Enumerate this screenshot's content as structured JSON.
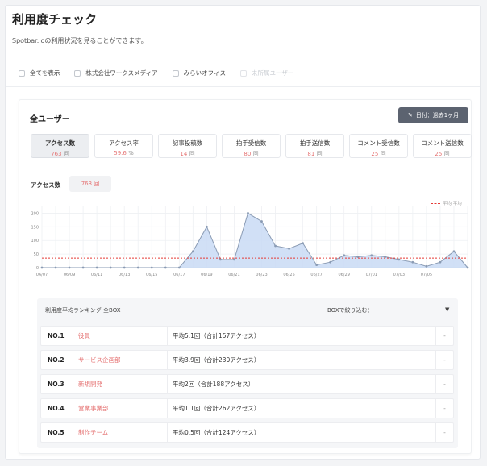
{
  "page": {
    "title": "利用度チェック",
    "description": "Spotbar.ioの利用状況を見ることができます。"
  },
  "filters": [
    {
      "label": "全てを表示",
      "disabled": false
    },
    {
      "label": "株式会社ワークスメディア",
      "disabled": false
    },
    {
      "label": "みらいオフィス",
      "disabled": false
    },
    {
      "label": "未所属ユーザー",
      "disabled": true
    }
  ],
  "card": {
    "title": "全ユーザー",
    "date_button": "日付：過去1ヶ月"
  },
  "tabs": [
    {
      "label": "アクセス数",
      "value": "763",
      "unit": "回",
      "active": true
    },
    {
      "label": "アクセス率",
      "value": "59.6",
      "unit": "%",
      "active": false
    },
    {
      "label": "記事投稿数",
      "value": "14",
      "unit": "回",
      "active": false
    },
    {
      "label": "拍手受信数",
      "value": "80",
      "unit": "回",
      "active": false
    },
    {
      "label": "拍手送信数",
      "value": "81",
      "unit": "回",
      "active": false
    },
    {
      "label": "コメント受信数",
      "value": "25",
      "unit": "回",
      "active": false
    },
    {
      "label": "コメント送信数",
      "value": "25",
      "unit": "回",
      "active": false
    }
  ],
  "metric": {
    "label": "アクセス数",
    "value": "763 回"
  },
  "chart_data": {
    "type": "area",
    "x": [
      "06/07",
      "06/08",
      "06/09",
      "06/10",
      "06/11",
      "06/12",
      "06/13",
      "06/14",
      "06/15",
      "06/16",
      "06/17",
      "06/18",
      "06/19",
      "06/20",
      "06/21",
      "06/22",
      "06/23",
      "06/24",
      "06/25",
      "06/26",
      "06/27",
      "06/28",
      "06/29",
      "06/30",
      "07/01",
      "07/02",
      "07/03",
      "07/04",
      "07/05",
      "07/06"
    ],
    "x_ticks": [
      "06/07",
      "06/09",
      "06/11",
      "06/13",
      "06/15",
      "06/17",
      "06/19",
      "06/21",
      "06/23",
      "06/25",
      "06/27",
      "06/29",
      "07/01",
      "07/03",
      "07/05"
    ],
    "y_ticks": [
      "0",
      "50",
      "100",
      "150",
      "200"
    ],
    "ylim": [
      0,
      225
    ],
    "series": [
      {
        "values": [
          0,
          0,
          0,
          0,
          0,
          0,
          0,
          0,
          0,
          0,
          0,
          60,
          150,
          30,
          30,
          200,
          170,
          80,
          70,
          90,
          10,
          20,
          45,
          40,
          45,
          40,
          30,
          20,
          5,
          20,
          60,
          0
        ],
        "color": "#8a9bb4",
        "fill": "#c9dbf5"
      }
    ],
    "average": {
      "label": "平均 平均",
      "value": 35,
      "color": "#e53935"
    },
    "grid": true
  },
  "ranking": {
    "title": "利用度平均ランキング 全BOX",
    "filter_label": "BOXで絞り込む：",
    "filter_caret": "▼",
    "action_glyph": "-",
    "rows": [
      {
        "no": "NO.1",
        "name": "役員",
        "stat": "平均5.1回（合計157アクセス）"
      },
      {
        "no": "NO.2",
        "name": "サービス企画部",
        "stat": "平均3.9回（合計230アクセス）"
      },
      {
        "no": "NO.3",
        "name": "新規開発",
        "stat": "平均2回（合計188アクセス）"
      },
      {
        "no": "NO.4",
        "name": "営業事業部",
        "stat": "平均1.1回（合計262アクセス）"
      },
      {
        "no": "NO.5",
        "name": "制作チーム",
        "stat": "平均0.5回（合計124アクセス）"
      }
    ]
  }
}
